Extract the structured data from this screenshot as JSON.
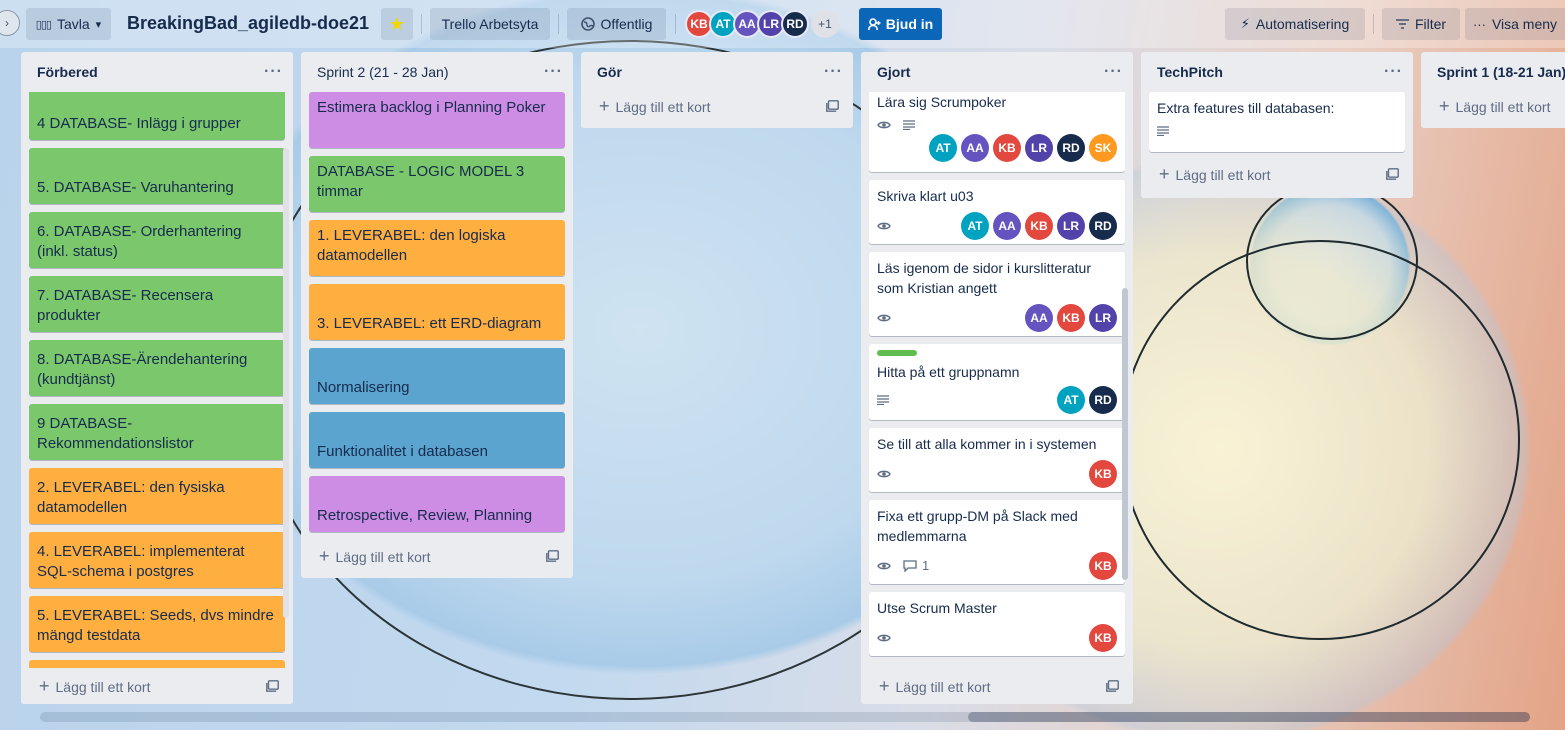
{
  "header": {
    "view_button": "Tavla",
    "board_title": "BreakingBad_agiledb-doe21",
    "workspace": "Trello Arbetsyta",
    "visibility": "Offentlig",
    "members": [
      {
        "initials": "KB",
        "color": "#e2483d"
      },
      {
        "initials": "AT",
        "color": "#00a3bf"
      },
      {
        "initials": "AA",
        "color": "#6554c0"
      },
      {
        "initials": "LR",
        "color": "#5243aa"
      },
      {
        "initials": "RD",
        "color": "#172b4d"
      }
    ],
    "more_members": "+1",
    "invite": "Bjud in",
    "automation": "Automatisering",
    "filter": "Filter",
    "menu": "Visa meny"
  },
  "add_card_label": "Lägg till ett kort",
  "lists": {
    "forbered": {
      "title": "Förbered",
      "cards": [
        {
          "text": "4 DATABASE- Inlägg i grupper",
          "color": "green"
        },
        {
          "text": "5. DATABASE- Varuhantering",
          "color": "green"
        },
        {
          "text": "6. DATABASE- Orderhantering (inkl. status)",
          "color": "green"
        },
        {
          "text": "7. DATABASE- Recensera produkter",
          "color": "green"
        },
        {
          "text": "8. DATABASE-Ärendehantering (kundtjänst)",
          "color": "green"
        },
        {
          "text": "9 DATABASE- Rekommendationslistor",
          "color": "green"
        },
        {
          "text": "2. LEVERABEL: den fysiska datamodellen",
          "color": "orange"
        },
        {
          "text": "4. LEVERABEL: implementerat SQL-schema i postgres",
          "color": "orange"
        },
        {
          "text": "5. LEVERABEL: Seeds, dvs mindre mängd testdata",
          "color": "orange"
        }
      ]
    },
    "sprint2": {
      "title": "Sprint 2 (21 - 28 Jan)",
      "cards": [
        {
          "text": "Estimera backlog i Planning Poker",
          "color": "purple"
        },
        {
          "text": "DATABASE - LOGIC MODEL 3 timmar",
          "color": "green"
        },
        {
          "text": "1. LEVERABEL: den logiska datamodellen",
          "color": "orange"
        },
        {
          "text": "3. LEVERABEL: ett ERD-diagram",
          "color": "orange"
        },
        {
          "text": "Normalisering",
          "color": "blue"
        },
        {
          "text": "Funktionalitet i databasen",
          "color": "blue"
        },
        {
          "text": "Retrospective, Review, Planning",
          "color": "purple"
        }
      ]
    },
    "gor": {
      "title": "Gör",
      "cards": []
    },
    "gjort": {
      "title": "Gjort",
      "cards": [
        {
          "text": "Lära sig Scrumpoker",
          "watch": true,
          "description": true,
          "members": [
            "AT",
            "AA",
            "KB",
            "LR",
            "RD",
            "SK"
          ]
        },
        {
          "text": "Skriva klart u03",
          "watch": true,
          "members": [
            "AT",
            "AA",
            "KB",
            "LR",
            "RD"
          ]
        },
        {
          "text": "Läs igenom de sidor i kurslitteratur som Kristian angett",
          "watch": true,
          "members": [
            "AA",
            "KB",
            "LR"
          ]
        },
        {
          "text": "Hitta på ett gruppnamn",
          "label": "green",
          "description": true,
          "members": [
            "AT",
            "RD"
          ]
        },
        {
          "text": "Se till att alla kommer in i systemen",
          "watch": true,
          "members": [
            "KB"
          ]
        },
        {
          "text": "Fixa ett grupp-DM på Slack med medlemmarna",
          "watch": true,
          "comments": "1",
          "members": [
            "KB"
          ]
        },
        {
          "text": "Utse Scrum Master",
          "watch": true,
          "members": [
            "KB"
          ]
        }
      ]
    },
    "techpitch": {
      "title": "TechPitch",
      "cards": [
        {
          "text": "Extra features till databasen:",
          "description": true
        }
      ]
    },
    "sprint1": {
      "title": "Sprint 1 (18-21 Jan)",
      "cards": []
    }
  },
  "member_colors": {
    "AT": "#00a3bf",
    "AA": "#6554c0",
    "KB": "#e2483d",
    "LR": "#5243aa",
    "RD": "#172b4d",
    "SK": "#ff991f"
  }
}
